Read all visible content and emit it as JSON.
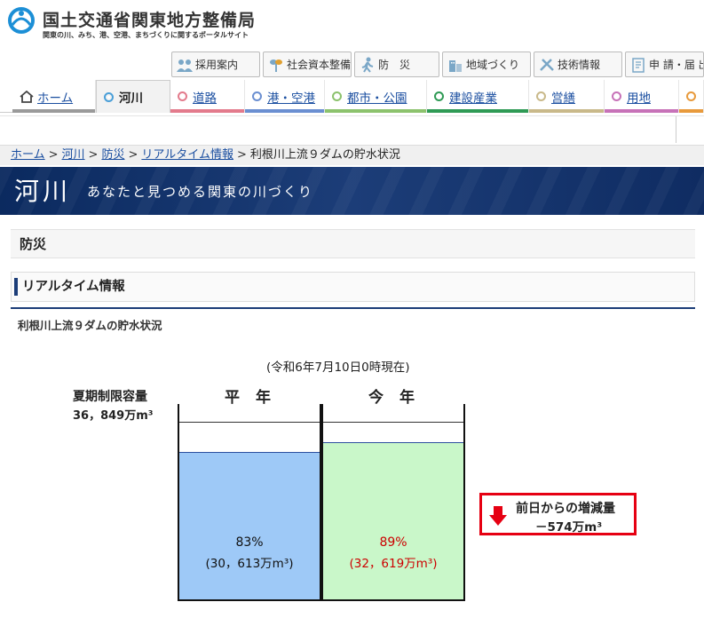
{
  "header": {
    "org_name": "国土交通省関東地方整備局",
    "tagline": "関東の川、みち、港、空港、まちづくりに関するポータルサイト"
  },
  "utility_nav": [
    {
      "label": "採用案内",
      "icon": "people-icon"
    },
    {
      "label": "社会資本整備",
      "icon": "plant-icon"
    },
    {
      "label": "防　災",
      "icon": "person-running-icon"
    },
    {
      "label": "地域づくり",
      "icon": "building-icon"
    },
    {
      "label": "技術情報",
      "icon": "tools-icon"
    },
    {
      "label": "申 請・届 出",
      "icon": "document-icon"
    }
  ],
  "main_nav": [
    {
      "label": "ホーム",
      "color": "#9a9a9a"
    },
    {
      "label": "河川",
      "color": "#4a9fd8"
    },
    {
      "label": "道路",
      "color": "#e37b8c"
    },
    {
      "label": "港・空港",
      "color": "#6b8fd1"
    },
    {
      "label": "都市・公園",
      "color": "#8cc26d"
    },
    {
      "label": "建設産業",
      "color": "#2f9a55"
    },
    {
      "label": "営繕",
      "color": "#c9b98a"
    },
    {
      "label": "用地",
      "color": "#c772b8"
    },
    {
      "label": "",
      "color": "#e89a3c"
    }
  ],
  "breadcrumb": {
    "links": [
      "ホーム",
      "河川",
      "防災",
      "リアルタイム情報"
    ],
    "current": "利根川上流９ダムの貯水状況"
  },
  "banner": {
    "title": "河川",
    "subtitle": "あなたと見つめる関東の川づくり"
  },
  "section": {
    "h1": "防災",
    "h2": "リアルタイム情報",
    "h3": "利根川上流９ダムの貯水状況"
  },
  "storage": {
    "as_of": "(令和6年7月10日0時現在)",
    "capacity_label": "夏期制限容量",
    "capacity_value": "36，849万m³",
    "normal": {
      "heading": "平 年",
      "percent_text": "83%",
      "volume_text": "(30，613万m³)",
      "fill_fraction": 0.83,
      "color": "#9ec9f7",
      "text_color": "#111111"
    },
    "current": {
      "heading": "今 年",
      "percent_text": "89%",
      "volume_text": "(32，619万m³)",
      "fill_fraction": 0.885,
      "color": "#c9f7c9",
      "text_color": "#cc0000"
    },
    "delta_label": "前日からの増減量",
    "delta_value": "－574万m³"
  }
}
